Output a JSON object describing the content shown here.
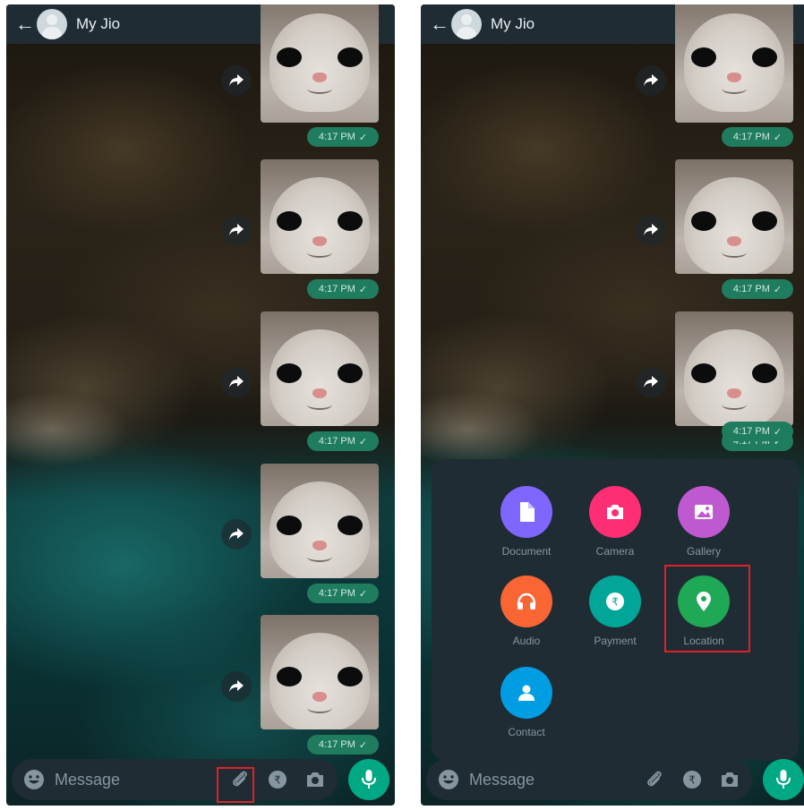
{
  "left_panel": {
    "header": {
      "back": "←",
      "title": "My Jio"
    },
    "messages": [
      {
        "time": "4:17 PM"
      },
      {
        "time": "4:17 PM"
      },
      {
        "time": "4:17 PM"
      },
      {
        "time": "4:17 PM"
      },
      {
        "time": "4:17 PM"
      }
    ],
    "input": {
      "placeholder": "Message"
    }
  },
  "right_panel": {
    "header": {
      "back": "←",
      "title": "My Jio"
    },
    "messages": [
      {
        "time": "4:17 PM"
      },
      {
        "time": "4:17 PM"
      },
      {
        "time": "4:17 PM"
      },
      {
        "time": "4:17 PM"
      }
    ],
    "input": {
      "placeholder": "Message"
    },
    "attach_menu": [
      {
        "label": "Document",
        "color": "#7f66ff",
        "icon": "document-icon"
      },
      {
        "label": "Camera",
        "color": "#fe2e74",
        "icon": "camera-icon"
      },
      {
        "label": "Gallery",
        "color": "#bf59cf",
        "icon": "gallery-icon"
      },
      {
        "label": "Audio",
        "color": "#f96533",
        "icon": "headphones-icon"
      },
      {
        "label": "Payment",
        "color": "#02a698",
        "icon": "rupee-icon"
      },
      {
        "label": "Location",
        "color": "#1fa855",
        "icon": "location-pin-icon"
      },
      {
        "label": "Contact",
        "color": "#009de2",
        "icon": "contact-icon"
      }
    ]
  },
  "colors": {
    "header_bg": "#1f2c33",
    "timestamp_bg": "#1f7c5f",
    "mic_bg": "#00a884",
    "highlight": "#e0212a"
  }
}
